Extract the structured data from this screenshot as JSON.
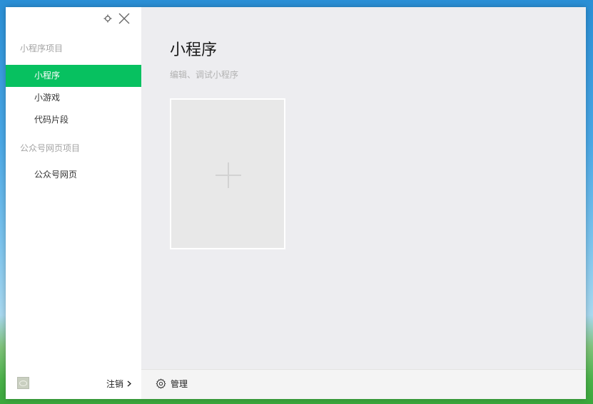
{
  "sidebar": {
    "sections": [
      {
        "label": "小程序项目",
        "items": [
          {
            "label": "小程序",
            "active": true
          },
          {
            "label": "小游戏",
            "active": false
          },
          {
            "label": "代码片段",
            "active": false
          }
        ]
      },
      {
        "label": "公众号网页项目",
        "items": [
          {
            "label": "公众号网页",
            "active": false
          }
        ]
      }
    ],
    "footer": {
      "logout_label": "注销"
    }
  },
  "main": {
    "title": "小程序",
    "subtitle": "编辑、调试小程序"
  },
  "bottom_bar": {
    "manage_label": "管理"
  },
  "colors": {
    "accent": "#07c160",
    "main_bg": "#ededf0",
    "card_bg": "#e8e8e8"
  },
  "icons": [
    "settings-icon",
    "close-icon",
    "avatar",
    "chevron-right-icon",
    "plus-icon",
    "gear-icon"
  ]
}
